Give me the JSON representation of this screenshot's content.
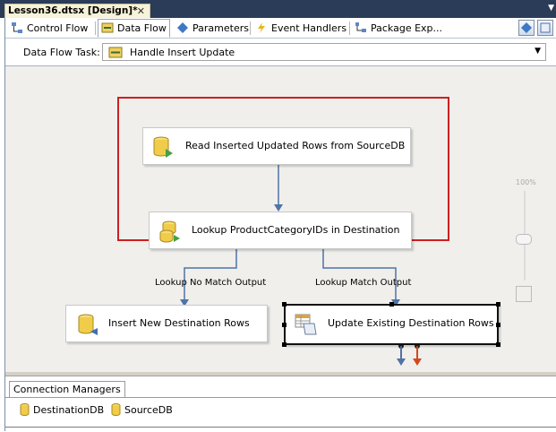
{
  "document": {
    "tab_title": "Lesson36.dtsx [Design]*",
    "close_glyph": "✕"
  },
  "designer_tabs": [
    {
      "label": "Control Flow",
      "icon": "control-flow-icon"
    },
    {
      "label": "Data Flow",
      "icon": "data-flow-icon",
      "active": true
    },
    {
      "label": "Parameters",
      "icon": "parameters-icon"
    },
    {
      "label": "Event Handlers",
      "icon": "event-handlers-icon"
    },
    {
      "label": "Package Exp...",
      "icon": "package-explorer-icon"
    }
  ],
  "task_bar": {
    "label": "Data Flow Task:",
    "selected": "Handle Insert Update"
  },
  "components": {
    "source": {
      "label": "Read Inserted Updated Rows from SourceDB",
      "icon": "source-db-icon"
    },
    "lookup": {
      "label": "Lookup ProductCategoryIDs in Destination",
      "icon": "lookup-icon"
    },
    "insert": {
      "label": "Insert New Destination Rows",
      "icon": "destination-db-icon"
    },
    "update": {
      "label": "Update Existing Destination Rows",
      "icon": "ole-db-command-icon"
    }
  },
  "paths": {
    "no_match": "Lookup No Match Output",
    "match": "Lookup Match Output"
  },
  "zoom": {
    "label": "100%"
  },
  "connection_managers": {
    "tab_label": "Connection Managers",
    "items": [
      {
        "label": "DestinationDB",
        "icon": "database-icon"
      },
      {
        "label": "SourceDB",
        "icon": "database-icon"
      }
    ]
  },
  "colors": {
    "highlight": "#cc2020",
    "path": "#4e73a6",
    "error_path": "#d24a1c"
  }
}
